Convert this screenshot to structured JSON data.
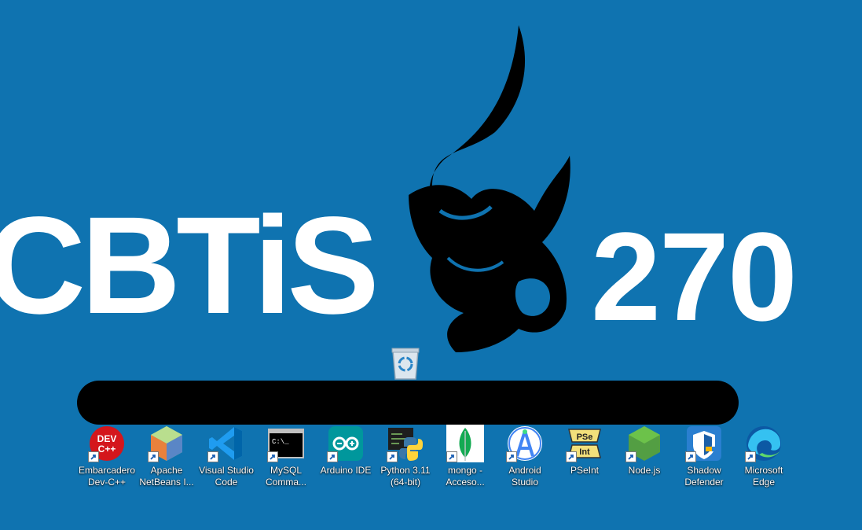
{
  "wallpaper": {
    "left_text": "CBTiS",
    "right_text": "270",
    "background_color": "#0f73b0",
    "mascot_icon": "bull-mascot-icon"
  },
  "desktop": {
    "recycle_bin_icon": "recycle-bin-icon",
    "icons": [
      {
        "line1": "Embarcadero",
        "line2": "Dev-C++",
        "icon": "devcpp-icon"
      },
      {
        "line1": "Apache",
        "line2": "NetBeans I...",
        "icon": "netbeans-icon"
      },
      {
        "line1": "Visual Studio",
        "line2": "Code",
        "icon": "vscode-icon"
      },
      {
        "line1": "MySQL",
        "line2": "Comma...",
        "icon": "mysql-console-icon"
      },
      {
        "line1": "Arduino IDE",
        "line2": "",
        "icon": "arduino-icon"
      },
      {
        "line1": "Python 3.11",
        "line2": "(64-bit)",
        "icon": "python-icon"
      },
      {
        "line1": "mongo -",
        "line2": "Acceso...",
        "icon": "mongodb-icon"
      },
      {
        "line1": "Android",
        "line2": "Studio",
        "icon": "android-studio-icon"
      },
      {
        "line1": "PSeInt",
        "line2": "",
        "icon": "pseint-icon"
      },
      {
        "line1": "Node.js",
        "line2": "",
        "icon": "nodejs-icon"
      },
      {
        "line1": "Shadow",
        "line2": "Defender",
        "icon": "shadow-defender-icon"
      },
      {
        "line1": "Microsoft",
        "line2": "Edge",
        "icon": "edge-icon"
      }
    ],
    "icon_glyphs": {
      "devcpp": [
        "DEV",
        "C++"
      ],
      "mysql": "C:\\_",
      "pseint": [
        "PSe",
        "Int"
      ]
    }
  }
}
